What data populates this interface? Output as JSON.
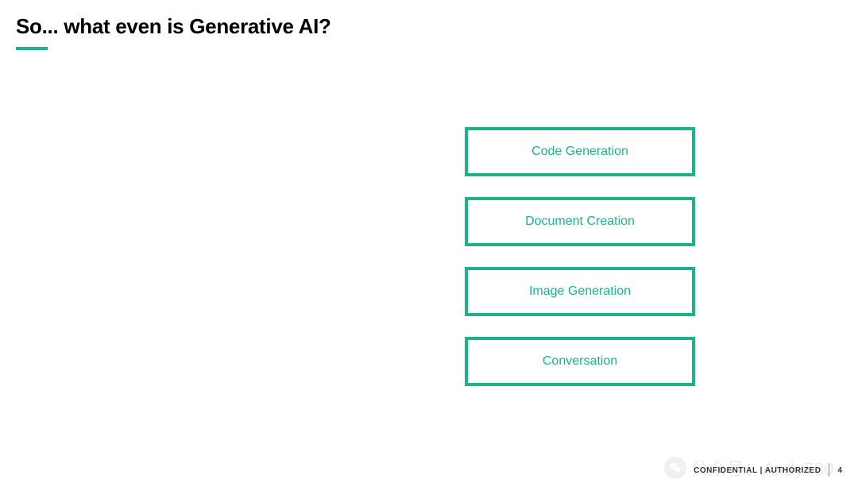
{
  "title": "So... what even is Generative AI?",
  "boxes": [
    {
      "label": "Code Generation"
    },
    {
      "label": "Document Creation"
    },
    {
      "label": "Image Generation"
    },
    {
      "label": "Conversation"
    }
  ],
  "footer": {
    "confidentiality": "CONFIDENTIAL | AUTHORIZED",
    "page_number": "4"
  },
  "watermark": {
    "label": "公众号：Andy730"
  },
  "colors": {
    "accent": "#1fb28a"
  }
}
